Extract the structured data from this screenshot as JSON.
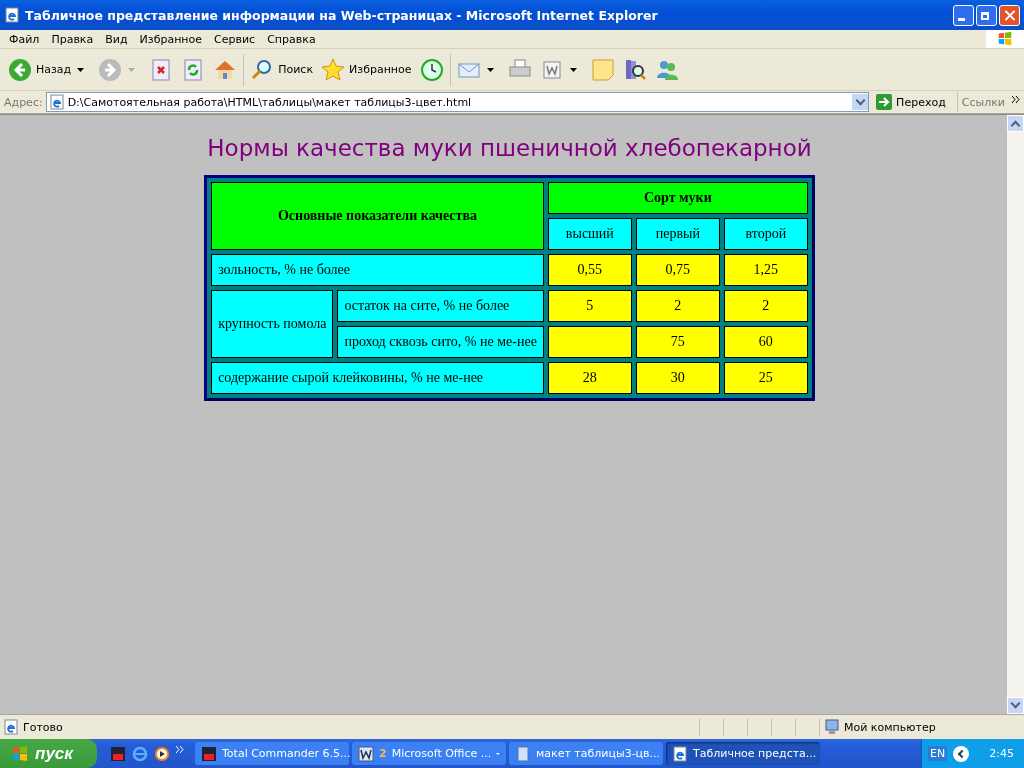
{
  "window": {
    "title": "Табличное представление информации на Web-страницах - Microsoft Internet Explorer"
  },
  "menu": [
    "Файл",
    "Правка",
    "Вид",
    "Избранное",
    "Сервис",
    "Справка"
  ],
  "toolbar": [
    {
      "kind": "back",
      "label": "Назад"
    },
    {
      "kind": "forward"
    },
    {
      "kind": "stop"
    },
    {
      "kind": "refresh"
    },
    {
      "kind": "home"
    },
    {
      "kind": "search",
      "label": "Поиск"
    },
    {
      "kind": "favorites",
      "label": "Избранное"
    },
    {
      "kind": "history"
    },
    {
      "kind": "mail"
    },
    {
      "kind": "print"
    },
    {
      "kind": "edit"
    },
    {
      "kind": "note"
    },
    {
      "kind": "research"
    },
    {
      "kind": "messenger"
    }
  ],
  "address": {
    "label": "Адрес:",
    "value": "D:\\Самотоятельная работа\\HTML\\таблицы\\макет таблицы3-цвет.html",
    "go": "Переход",
    "links": "Ссылки"
  },
  "page": {
    "heading": "Нормы качества муки пшеничной хлебопекарной",
    "table": {
      "main_header": "Основные показатели качества",
      "group_header": "Сорт муки",
      "grades": [
        "высший",
        "первый",
        "второй"
      ],
      "rows": [
        {
          "kind": "single",
          "label": "зольность, % не более",
          "cells": [
            {
              "value": "0,55"
            },
            {
              "value": "0,75"
            },
            {
              "value": "1,25"
            }
          ]
        },
        {
          "kind": "group",
          "label": "крупность помола",
          "children": [
            {
              "label": "остаток на сите, % не более",
              "cells": [
                {
                  "value": "5"
                },
                {
                  "value": "2"
                },
                {
                  "value": "2"
                }
              ]
            },
            {
              "label": "проход сквозь сито, % не ме-нее",
              "cells": [
                {
                  "blank": true
                },
                {
                  "value": "75"
                },
                {
                  "value": "60"
                }
              ]
            }
          ]
        },
        {
          "kind": "single",
          "label": "содержание сырой клейковины, % не ме-нее",
          "cells": [
            {
              "value": "28"
            },
            {
              "value": "30"
            },
            {
              "value": "25"
            }
          ]
        }
      ]
    }
  },
  "status_bar": {
    "text": "Готово",
    "zone": "Мой компьютер"
  },
  "taskbar": {
    "start": "пуск",
    "tasks": [
      {
        "kind": "commander",
        "label": "Total Commander 6.5...",
        "selected": false
      },
      {
        "kind": "word",
        "count": "2",
        "label": "Microsoft Office ...",
        "selected": false
      },
      {
        "kind": "notepad",
        "label": "макет таблицы3-цв...",
        "selected": false
      },
      {
        "kind": "ie",
        "label": "Табличное предста...",
        "selected": true
      }
    ],
    "language": "EN",
    "clock": "2:45"
  }
}
